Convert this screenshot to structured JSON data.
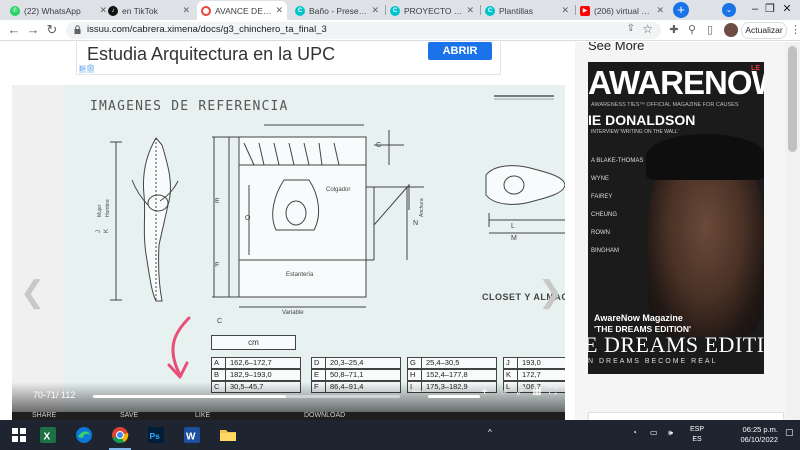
{
  "browser": {
    "tabs": [
      {
        "title": "(22) WhatsApp",
        "icon": "whatsapp-icon",
        "color": "#25d366",
        "active": false
      },
      {
        "title": "en TikTok",
        "icon": "tiktok-icon",
        "color": "#111111",
        "active": false
      },
      {
        "title": "AVANCE DE PROY",
        "icon": "chromecast-icon",
        "color": "#e8453c",
        "active": true
      },
      {
        "title": "Baño - Presentacio",
        "icon": "canva-icon",
        "color": "#00c4cc",
        "active": false
      },
      {
        "title": "PROYECTO TURISTI",
        "icon": "canva-icon",
        "color": "#00c4cc",
        "active": false
      },
      {
        "title": "Plantillas",
        "icon": "canva-icon",
        "color": "#00c4cc",
        "active": false
      },
      {
        "title": "(206) virtual diva",
        "icon": "youtube-icon",
        "color": "#ff0000",
        "active": false
      }
    ],
    "new_tab_label": "+",
    "url": "issuu.com/cabrera.ximena/docs/g3_chinchero_ta_final_3",
    "update_label": "Actualizar"
  },
  "ad": {
    "title": "Estudia Arquitectura en la UPC",
    "button": "ABRIR"
  },
  "document": {
    "heading": "IMAGENES DE REFERENCIA",
    "labels": {
      "colgador": "Colgador",
      "estanteria": "Estantería",
      "variable": "Variable",
      "closet": "CLOSET Y ALMAC",
      "mujer": "Mujer",
      "hombre": "Hombre",
      "anchura": "Anchura"
    },
    "table_header": "cm",
    "table_rows": [
      [
        "A",
        "162,6–172,7",
        "D",
        "20,3–25,4",
        "G",
        "25,4–30,5",
        "J",
        "193,0"
      ],
      [
        "B",
        "182,9–193,0",
        "E",
        "50,8–71,1",
        "H",
        "152,4–177,8",
        "K",
        "172,7"
      ],
      [
        "C",
        "30,5–45,7",
        "F",
        "86,4–91,4",
        "I",
        "175,3–182,9",
        "L",
        "106,7"
      ]
    ]
  },
  "viewer": {
    "page_count": "70-71/ 112",
    "progress_fraction": 0.63,
    "actions": [
      "SHARE",
      "SAVE",
      "LIKE",
      "DOWNLOAD"
    ]
  },
  "sidebar": {
    "see_more": "See More",
    "magazine": {
      "masthead": "AWARENOW",
      "tagline": "AWARENESS TIES™ OFFICIAL MAGAZINE FOR CAUSES",
      "feature": "IE DONALDSON",
      "interview": "INTERVIEW 'WRITING ON THE WALL'",
      "side_names": [
        "A BLAKE-THOMAS",
        "WYNE",
        "FAIREY",
        "CHEUNG",
        "ROWN",
        "BINGHAM"
      ],
      "caption_line1": "AwareNow Magazine",
      "caption_line2": "'THE DREAMS EDITION'",
      "big_text": "E DREAMS EDITIO",
      "small_text": "N DREAMS BECOME REAL",
      "badge": "LE"
    }
  },
  "taskbar": {
    "lang": "ESP",
    "lang_sub": "ES",
    "time": "06:25 p.m.",
    "date": "06/10/2022"
  }
}
